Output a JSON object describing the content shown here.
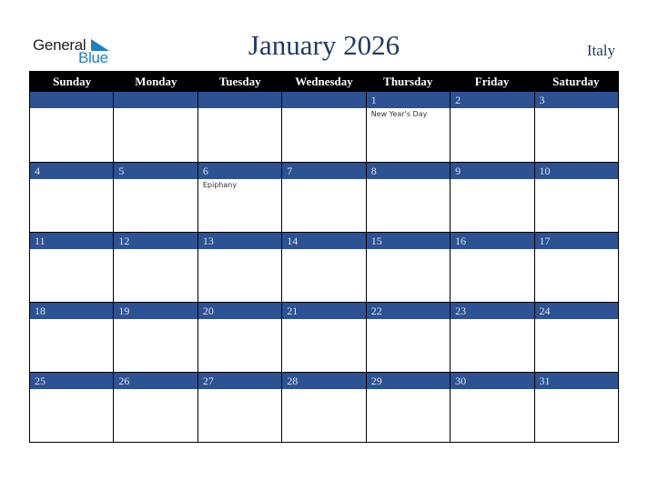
{
  "logo": {
    "line1": "General",
    "line2": "Blue"
  },
  "title": "January 2026",
  "country": "Italy",
  "weekdays": [
    "Sunday",
    "Monday",
    "Tuesday",
    "Wednesday",
    "Thursday",
    "Friday",
    "Saturday"
  ],
  "weeks": [
    [
      {
        "day": "",
        "event": ""
      },
      {
        "day": "",
        "event": ""
      },
      {
        "day": "",
        "event": ""
      },
      {
        "day": "",
        "event": ""
      },
      {
        "day": "1",
        "event": "New Year's Day"
      },
      {
        "day": "2",
        "event": ""
      },
      {
        "day": "3",
        "event": ""
      }
    ],
    [
      {
        "day": "4",
        "event": ""
      },
      {
        "day": "5",
        "event": ""
      },
      {
        "day": "6",
        "event": "Epiphany"
      },
      {
        "day": "7",
        "event": ""
      },
      {
        "day": "8",
        "event": ""
      },
      {
        "day": "9",
        "event": ""
      },
      {
        "day": "10",
        "event": ""
      }
    ],
    [
      {
        "day": "11",
        "event": ""
      },
      {
        "day": "12",
        "event": ""
      },
      {
        "day": "13",
        "event": ""
      },
      {
        "day": "14",
        "event": ""
      },
      {
        "day": "15",
        "event": ""
      },
      {
        "day": "16",
        "event": ""
      },
      {
        "day": "17",
        "event": ""
      }
    ],
    [
      {
        "day": "18",
        "event": ""
      },
      {
        "day": "19",
        "event": ""
      },
      {
        "day": "20",
        "event": ""
      },
      {
        "day": "21",
        "event": ""
      },
      {
        "day": "22",
        "event": ""
      },
      {
        "day": "23",
        "event": ""
      },
      {
        "day": "24",
        "event": ""
      }
    ],
    [
      {
        "day": "25",
        "event": ""
      },
      {
        "day": "26",
        "event": ""
      },
      {
        "day": "27",
        "event": ""
      },
      {
        "day": "28",
        "event": ""
      },
      {
        "day": "29",
        "event": ""
      },
      {
        "day": "30",
        "event": ""
      },
      {
        "day": "31",
        "event": ""
      }
    ]
  ],
  "colors": {
    "header_bg": "#000000",
    "day_bar": "#2d5293",
    "title": "#243a66",
    "logo_blue": "#1f7fc4"
  }
}
